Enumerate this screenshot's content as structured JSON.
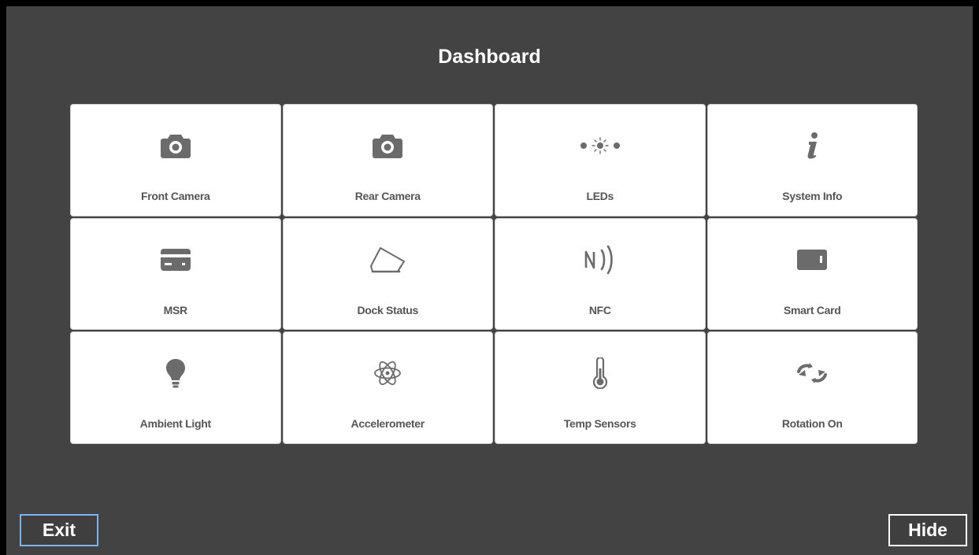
{
  "header": {
    "title": "Dashboard"
  },
  "tiles": [
    {
      "label": "Front Camera",
      "icon": "camera-icon"
    },
    {
      "label": "Rear Camera",
      "icon": "camera-icon"
    },
    {
      "label": "LEDs",
      "icon": "led-icon"
    },
    {
      "label": "System Info",
      "icon": "info-icon"
    },
    {
      "label": "MSR",
      "icon": "credit-card-icon"
    },
    {
      "label": "Dock Status",
      "icon": "tablet-dock-icon"
    },
    {
      "label": "NFC",
      "icon": "nfc-icon"
    },
    {
      "label": "Smart Card",
      "icon": "smart-card-icon"
    },
    {
      "label": "Ambient Light",
      "icon": "lightbulb-icon"
    },
    {
      "label": "Accelerometer",
      "icon": "atom-icon"
    },
    {
      "label": "Temp Sensors",
      "icon": "thermometer-icon"
    },
    {
      "label": "Rotation On",
      "icon": "rotation-icon"
    }
  ],
  "footer": {
    "exit_label": "Exit",
    "hide_label": "Hide"
  },
  "colors": {
    "background": "#434343",
    "tile": "#ffffff",
    "icon": "#6b6b6b",
    "exit_border": "#7fb3ff"
  }
}
